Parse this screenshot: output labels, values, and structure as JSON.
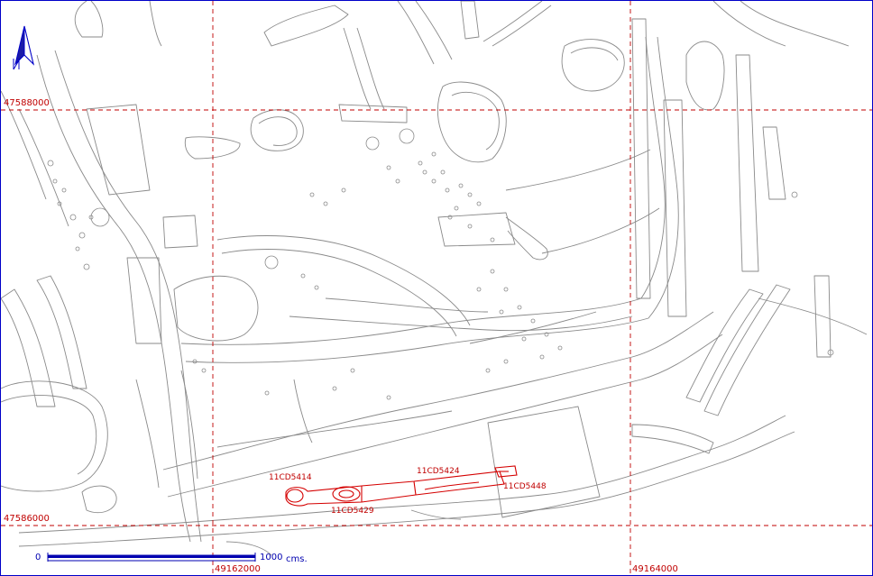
{
  "grid": {
    "y_labels": [
      "47588000",
      "47586000"
    ],
    "x_labels": [
      "49162000",
      "49164000"
    ]
  },
  "features": [
    "11CD5414",
    "11CD5424",
    "11CD5429",
    "11CD5448"
  ],
  "scale": {
    "start": "0",
    "end": "1000",
    "unit": "cms."
  },
  "north_arrow_label": "N",
  "colors": {
    "linework": "#8a8a8a",
    "grid": "#c00000",
    "highlight": "#d40000",
    "frame": "#0000c8",
    "scale": "#0000b0"
  }
}
